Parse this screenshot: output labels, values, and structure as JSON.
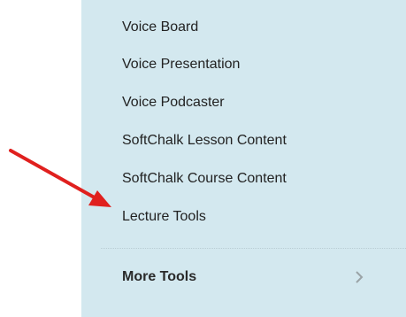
{
  "menu": {
    "items": [
      {
        "label": "Voice Board"
      },
      {
        "label": "Voice Presentation"
      },
      {
        "label": "Voice Podcaster"
      },
      {
        "label": "SoftChalk Lesson Content"
      },
      {
        "label": "SoftChalk Course Content"
      },
      {
        "label": "Lecture Tools"
      }
    ],
    "more_tools": {
      "label": "More Tools",
      "icon": "chevron-right-icon"
    }
  },
  "colors": {
    "panel_background": "#d3e8ef",
    "annotation_arrow": "#e0201e"
  }
}
